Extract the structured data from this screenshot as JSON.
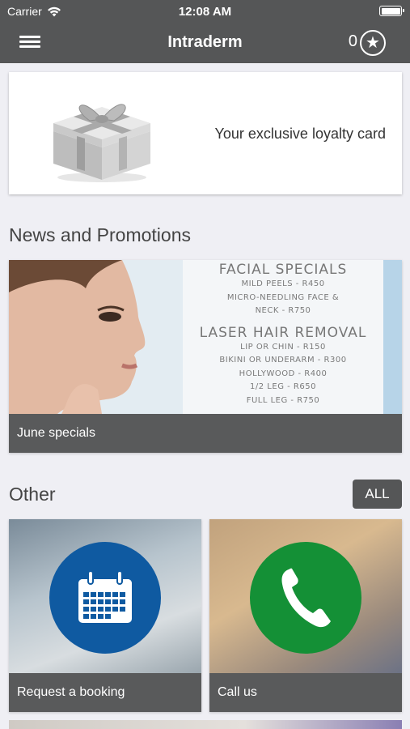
{
  "status_bar": {
    "carrier": "Carrier",
    "time": "12:08 AM"
  },
  "nav": {
    "title": "Intraderm",
    "points": "0"
  },
  "loyalty_card": {
    "text": "Your exclusive loyalty card"
  },
  "news": {
    "section_title": "News and Promotions",
    "card": {
      "caption": "June specials",
      "image_text": {
        "heading1": "FACIAL SPECIALS",
        "lines1": [
          "MILD PEELS - R450",
          "MICRO-NEEDLING FACE &",
          "NECK - R750"
        ],
        "heading2": "LASER HAIR REMOVAL",
        "lines2": [
          "LIP OR CHIN - R150",
          "BIKINI OR UNDERARM - R300",
          "HOLLYWOOD - R400",
          "1/2 LEG - R650",
          "FULL LEG - R750"
        ]
      }
    }
  },
  "other": {
    "section_title": "Other",
    "all_label": "ALL",
    "tiles": [
      {
        "label": "Request a booking",
        "icon": "calendar-icon",
        "color": "#0f5aa1"
      },
      {
        "label": "Call us",
        "icon": "phone-icon",
        "color": "#149036"
      }
    ]
  }
}
